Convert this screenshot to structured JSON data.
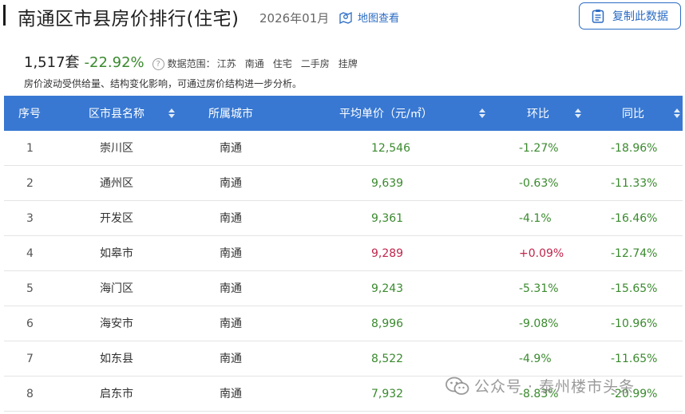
{
  "header": {
    "title": "南通区市县房价排行(住宅)",
    "period": "2026年01月",
    "map_link": "地图查看",
    "copy_button": "复制此数据"
  },
  "summary": {
    "count": "1,517套",
    "change": "-22.92%",
    "scope_label": "数据范围：",
    "scope": [
      "江苏",
      "南通",
      "住宅",
      "二手房",
      "挂牌"
    ]
  },
  "note": "房价波动受供给量、结构变化影响，可通过房价结构进一步分析。",
  "table": {
    "headers": {
      "no": "序号",
      "name": "区市县名称",
      "city": "所属城市",
      "price": "平均单价（元/㎡）",
      "mom": "环比",
      "yoy": "同比"
    },
    "rows": [
      {
        "no": "1",
        "name": "崇川区",
        "city": "南通",
        "price": "12,546",
        "mom": "-1.27%",
        "yoy": "-18.96%"
      },
      {
        "no": "2",
        "name": "通州区",
        "city": "南通",
        "price": "9,639",
        "mom": "-0.63%",
        "yoy": "-11.33%"
      },
      {
        "no": "3",
        "name": "开发区",
        "city": "南通",
        "price": "9,361",
        "mom": "-4.1%",
        "yoy": "-16.46%"
      },
      {
        "no": "4",
        "name": "如皋市",
        "city": "南通",
        "price": "9,289",
        "mom": "+0.09%",
        "yoy": "-12.74%"
      },
      {
        "no": "5",
        "name": "海门区",
        "city": "南通",
        "price": "9,243",
        "mom": "-5.31%",
        "yoy": "-15.65%"
      },
      {
        "no": "6",
        "name": "海安市",
        "city": "南通",
        "price": "8,996",
        "mom": "-9.08%",
        "yoy": "-10.96%"
      },
      {
        "no": "7",
        "name": "如东县",
        "city": "南通",
        "price": "8,522",
        "mom": "-4.9%",
        "yoy": "-11.65%"
      },
      {
        "no": "8",
        "name": "启东市",
        "city": "南通",
        "price": "7,932",
        "mom": "-8.83%",
        "yoy": "-20.99%"
      }
    ]
  },
  "watermark": "公众号 · 泰州楼市头条",
  "colors": {
    "header_bg": "#3878d2",
    "accent_blue": "#2b6cc4",
    "down_green": "#3a8a2e",
    "up_red": "#c0254b"
  }
}
